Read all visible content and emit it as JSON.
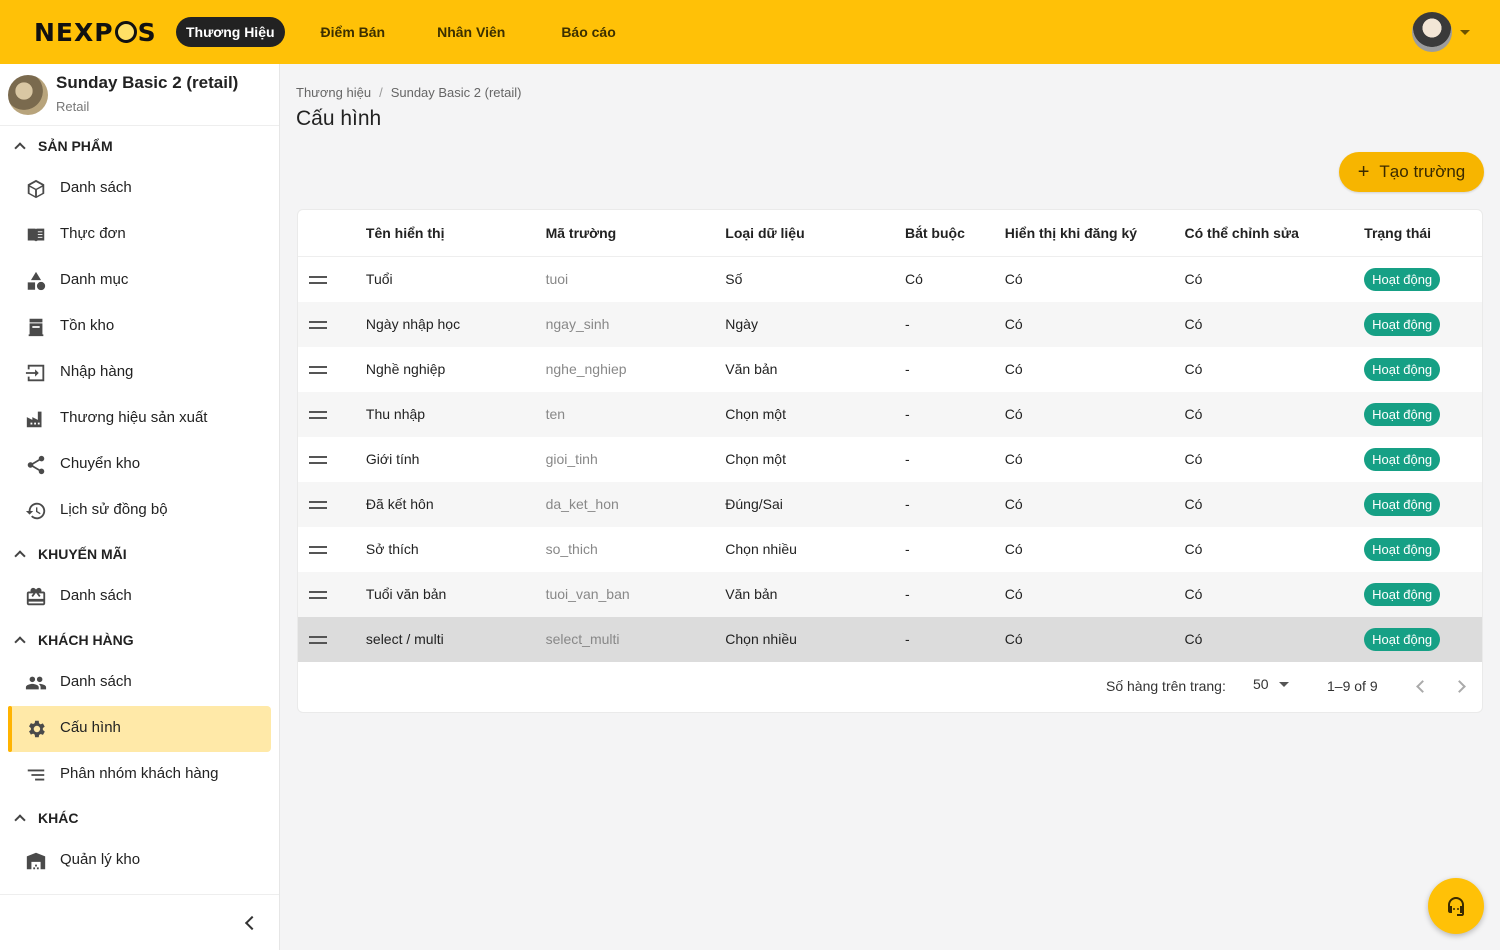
{
  "logo": {
    "pre": "NEXP",
    "post": "S"
  },
  "nav": [
    {
      "label": "Thương Hiệu",
      "active": true
    },
    {
      "label": "Điểm Bán",
      "active": false
    },
    {
      "label": "Nhân Viên",
      "active": false
    },
    {
      "label": "Báo cáo",
      "active": false
    }
  ],
  "brand": {
    "name": "Sunday Basic 2 (retail)",
    "type": "Retail"
  },
  "sidebar": {
    "sections": [
      {
        "label": "SẢN PHẨM",
        "items": [
          {
            "label": "Danh sách",
            "icon": "cube-icon"
          },
          {
            "label": "Thực đơn",
            "icon": "menu-book-icon"
          },
          {
            "label": "Danh mục",
            "icon": "category-icon"
          },
          {
            "label": "Tồn kho",
            "icon": "inventory-icon"
          },
          {
            "label": "Nhập hàng",
            "icon": "input-icon"
          },
          {
            "label": "Thương hiệu sản xuất",
            "icon": "factory-icon"
          },
          {
            "label": "Chuyển kho",
            "icon": "share-icon"
          },
          {
            "label": "Lịch sử đồng bộ",
            "icon": "history-icon"
          }
        ]
      },
      {
        "label": "KHUYẾN MÃI",
        "items": [
          {
            "label": "Danh sách",
            "icon": "giftcard-icon"
          }
        ]
      },
      {
        "label": "KHÁCH HÀNG",
        "items": [
          {
            "label": "Danh sách",
            "icon": "people-icon"
          },
          {
            "label": "Cấu hình",
            "icon": "gear-icon",
            "active": true
          },
          {
            "label": "Phân nhóm khách hàng",
            "icon": "sort-icon"
          }
        ]
      },
      {
        "label": "KHÁC",
        "items": [
          {
            "label": "Quản lý kho",
            "icon": "warehouse-icon"
          }
        ]
      }
    ]
  },
  "breadcrumb": [
    "Thương hiệu",
    "Sunday Basic 2 (retail)"
  ],
  "page": {
    "title": "Cấu hình",
    "create_label": "Tạo trường"
  },
  "table": {
    "columns": [
      "Tên hiển thị",
      "Mã trường",
      "Loại dữ liệu",
      "Bắt buộc",
      "Hiển thị khi đăng ký",
      "Có thể chỉnh sửa",
      "Trạng thái"
    ],
    "rows": [
      [
        "Tuổi",
        "tuoi",
        "Số",
        "Có",
        "Có",
        "Có",
        "Hoạt động"
      ],
      [
        "Ngày nhập học",
        "ngay_sinh",
        "Ngày",
        "-",
        "Có",
        "Có",
        "Hoạt động"
      ],
      [
        "Nghề nghiệp",
        "nghe_nghiep",
        "Văn bản",
        "-",
        "Có",
        "Có",
        "Hoạt động"
      ],
      [
        "Thu nhập",
        "ten",
        "Chọn một",
        "-",
        "Có",
        "Có",
        "Hoạt động"
      ],
      [
        "Giới tính",
        "gioi_tinh",
        "Chọn một",
        "-",
        "Có",
        "Có",
        "Hoạt động"
      ],
      [
        "Đã kết hôn",
        "da_ket_hon",
        "Đúng/Sai",
        "-",
        "Có",
        "Có",
        "Hoạt động"
      ],
      [
        "Sở thích",
        "so_thich",
        "Chọn nhiều",
        "-",
        "Có",
        "Có",
        "Hoạt động"
      ],
      [
        "Tuổi văn bản",
        "tuoi_van_ban",
        "Văn bản",
        "-",
        "Có",
        "Có",
        "Hoạt động"
      ],
      [
        "select / multi",
        "select_multi",
        "Chọn nhiều",
        "-",
        "Có",
        "Có",
        "Hoạt động"
      ]
    ],
    "highlighted_row": 8
  },
  "pagination": {
    "rows_per_page_label": "Số hàng trên trang:",
    "rows_per_page": "50",
    "range": "1–9 of 9"
  },
  "colors": {
    "brand": "#ffc107",
    "active_badge": "#16a085",
    "active_item_bg": "#ffe9a8"
  }
}
